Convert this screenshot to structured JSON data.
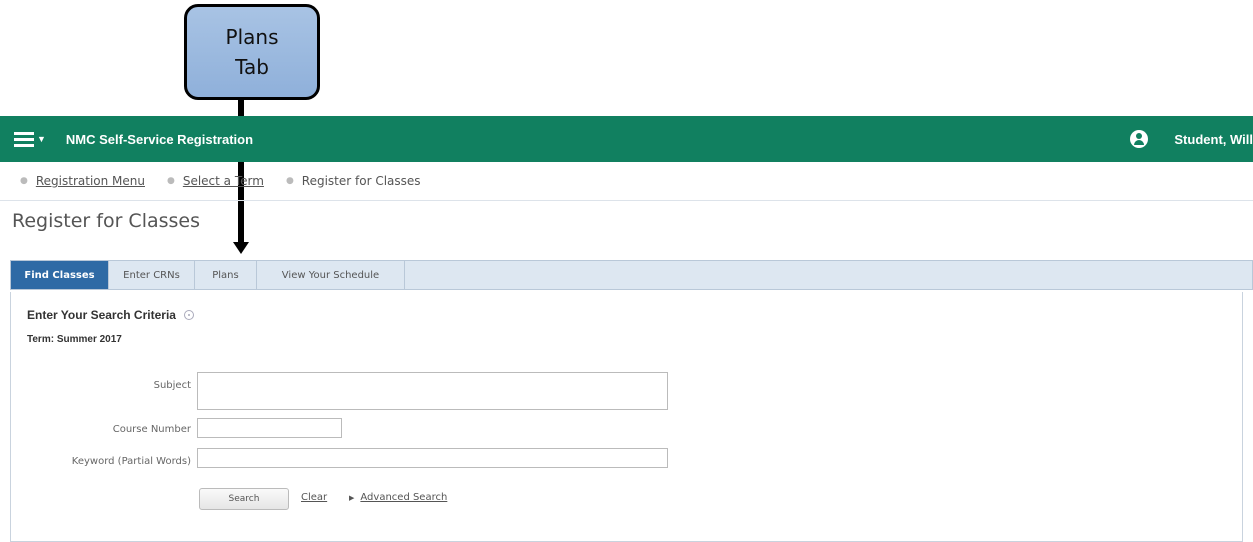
{
  "annotation": {
    "line1": "Plans",
    "line2": "Tab"
  },
  "header": {
    "app_title": "NMC Self-Service Registration",
    "user_name": "Student, Will",
    "color": "#118060"
  },
  "breadcrumb": [
    "Registration Menu",
    "Select a Term",
    "Register for Classes"
  ],
  "page_title": "Register for Classes",
  "tabs": [
    {
      "label": "Find Classes",
      "active": true
    },
    {
      "label": "Enter CRNs",
      "active": false
    },
    {
      "label": "Plans",
      "active": false
    },
    {
      "label": "View Your Schedule",
      "active": false
    }
  ],
  "search": {
    "title": "Enter Your Search Criteria",
    "term": "Term: Summer 2017",
    "subject_label": "Subject",
    "subject_value": "",
    "course_number_label": "Course Number",
    "course_number_value": "",
    "keyword_label": "Keyword (Partial Words)",
    "keyword_value": "",
    "search_button": "Search",
    "clear_link": "Clear",
    "advanced_search": "Advanced Search"
  },
  "icons": {
    "menu": "hamburger-icon",
    "user": "user-icon",
    "info": "info-icon",
    "expand": "triangle-right-icon"
  }
}
